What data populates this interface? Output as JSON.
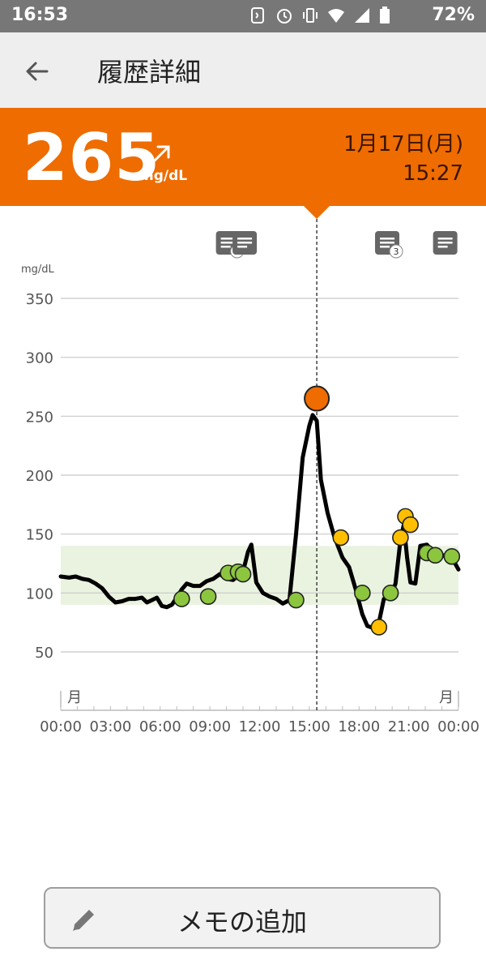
{
  "status_bar": {
    "time": "16:53",
    "battery": "72%"
  },
  "app_bar": {
    "title": "履歴詳細"
  },
  "reading": {
    "value": "265",
    "unit": "mg/dL",
    "trend": "rising",
    "date": "1月17日(月)",
    "time": "15:27"
  },
  "memo_button": {
    "label": "メモの追加"
  },
  "colors": {
    "banner": "#ee6c00",
    "target_range": "#eaf3e0",
    "point_in_range": "#8cc63f",
    "point_warning": "#ffbf00",
    "point_high": "#ee6c00"
  },
  "chart_data": {
    "type": "line",
    "yunit": "mg/dL",
    "ylim": [
      0,
      370
    ],
    "yticks": [
      50,
      100,
      150,
      200,
      250,
      300,
      350
    ],
    "xticks": [
      "00:00",
      "03:00",
      "06:00",
      "09:00",
      "12:00",
      "15:00",
      "18:00",
      "21:00",
      "00:00"
    ],
    "day_labels": {
      "start": "月",
      "end": "月"
    },
    "target_range": [
      90,
      140
    ],
    "selected_time_h": 15.45,
    "line": {
      "x": [
        0,
        0.5,
        0.9,
        1.3,
        1.7,
        2.1,
        2.5,
        2.9,
        3.3,
        3.7,
        4.1,
        4.5,
        4.9,
        5.2,
        5.5,
        5.8,
        6.1,
        6.4,
        6.7,
        7.0,
        7.3,
        7.6,
        8.0,
        8.4,
        8.8,
        9.2,
        9.6,
        10.0,
        10.4,
        10.8,
        11.0,
        11.3,
        11.5,
        11.8,
        12.2,
        12.6,
        13.0,
        13.4,
        13.8,
        14.2,
        14.6,
        15.0,
        15.2,
        15.45,
        15.7,
        16.1,
        16.5,
        17.0,
        17.4,
        17.8,
        18.2,
        18.5,
        18.9,
        19.2,
        19.5,
        19.9,
        20.2,
        20.5,
        20.7,
        20.9,
        21.1,
        21.4,
        21.7,
        22.1,
        22.4,
        22.8,
        23.2,
        23.6,
        24.0
      ],
      "y": [
        114,
        113,
        114,
        112,
        111,
        108,
        104,
        97,
        92,
        93,
        95,
        95,
        96,
        92,
        94,
        96,
        89,
        88,
        90,
        96,
        103,
        108,
        106,
        106,
        110,
        112,
        116,
        112,
        111,
        116,
        118,
        135,
        141,
        109,
        100,
        97,
        95,
        91,
        94,
        150,
        215,
        242,
        251,
        246,
        196,
        168,
        148,
        130,
        122,
        103,
        82,
        72,
        70,
        75,
        95,
        97,
        108,
        145,
        158,
        130,
        109,
        108,
        140,
        141,
        136,
        134,
        131,
        130,
        120
      ],
      "color": "#000000"
    },
    "points": [
      {
        "x": 7.3,
        "y": 95,
        "status": "in_range"
      },
      {
        "x": 8.9,
        "y": 97,
        "status": "in_range"
      },
      {
        "x": 10.1,
        "y": 117,
        "status": "in_range"
      },
      {
        "x": 10.7,
        "y": 118,
        "status": "in_range"
      },
      {
        "x": 11.0,
        "y": 116,
        "status": "in_range"
      },
      {
        "x": 14.2,
        "y": 94,
        "status": "in_range"
      },
      {
        "x": 15.45,
        "y": 265,
        "status": "high"
      },
      {
        "x": 16.9,
        "y": 147,
        "status": "warning"
      },
      {
        "x": 18.2,
        "y": 100,
        "status": "in_range"
      },
      {
        "x": 19.2,
        "y": 71,
        "status": "warning"
      },
      {
        "x": 19.9,
        "y": 100,
        "status": "in_range"
      },
      {
        "x": 20.5,
        "y": 147,
        "status": "warning"
      },
      {
        "x": 20.8,
        "y": 165,
        "status": "warning"
      },
      {
        "x": 21.1,
        "y": 158,
        "status": "warning"
      },
      {
        "x": 22.1,
        "y": 134,
        "status": "in_range"
      },
      {
        "x": 22.6,
        "y": 132,
        "status": "in_range"
      },
      {
        "x": 23.6,
        "y": 131,
        "status": "in_range"
      }
    ],
    "notes": [
      {
        "x": 10.1,
        "count": "3"
      },
      {
        "x": 11.1,
        "count": ""
      },
      {
        "x": 19.7,
        "count": "3"
      },
      {
        "x": 23.2,
        "count": ""
      }
    ]
  }
}
